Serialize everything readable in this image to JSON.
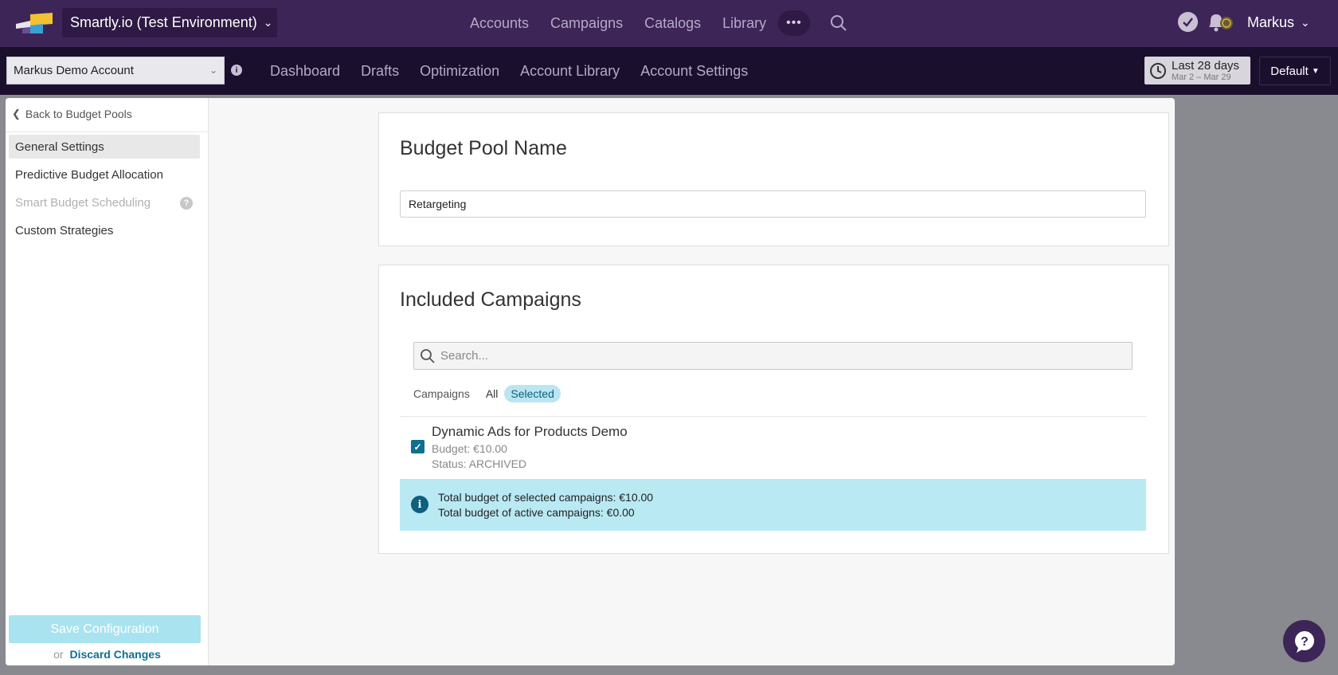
{
  "topbar": {
    "environment": "Smartly.io (Test Environment)",
    "nav": [
      "Accounts",
      "Campaigns",
      "Catalogs",
      "Library"
    ],
    "more": "•••",
    "user": "Markus"
  },
  "subbar": {
    "account": "Markus Demo Account",
    "nav": [
      "Dashboard",
      "Drafts",
      "Optimization",
      "Account Library",
      "Account Settings"
    ],
    "date_range": "Last 28 days",
    "date_detail": "Mar 2 – Mar 29",
    "view": "Default"
  },
  "sidebar": {
    "back": "Back to Budget Pools",
    "items": [
      {
        "label": "General Settings",
        "state": "active"
      },
      {
        "label": "Predictive Budget Allocation",
        "state": "normal"
      },
      {
        "label": "Smart Budget Scheduling",
        "state": "disabled"
      },
      {
        "label": "Custom Strategies",
        "state": "normal"
      }
    ],
    "save": "Save Configuration",
    "or": "or",
    "discard": "Discard Changes"
  },
  "budget_pool": {
    "title": "Budget Pool Name",
    "value": "Retargeting"
  },
  "campaigns_card": {
    "title": "Included Campaigns",
    "search_placeholder": "Search...",
    "filter_label": "Campaigns",
    "filter_all": "All",
    "filter_selected": "Selected",
    "campaign": {
      "name": "Dynamic Ads for Products Demo",
      "budget": "Budget: €10.00",
      "status": "Status: ARCHIVED",
      "checked": true
    },
    "info_selected": "Total budget of selected campaigns: €10.00",
    "info_active": "Total budget of active campaigns: €0.00"
  },
  "colors": {
    "topbar": "#3d2557",
    "subbar": "#1b0f2e",
    "accent": "#0f6f8f",
    "info_bg": "#b9e9f3"
  }
}
